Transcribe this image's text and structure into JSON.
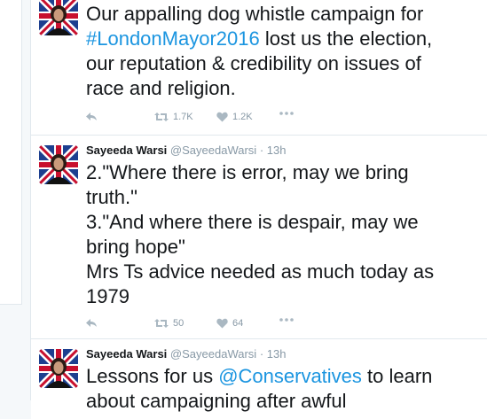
{
  "tweets": [
    {
      "author": "",
      "handle": "",
      "time": "",
      "text_lines": [
        [
          "Our appalling dog whistle campaign for"
        ],
        [
          "#LondonMayor2016",
          " lost us the election,"
        ],
        [
          "our reputation & credibility on issues of"
        ],
        [
          "race and religion."
        ]
      ],
      "retweets": "1.7K",
      "likes": "1.2K"
    },
    {
      "author": "Sayeeda Warsi",
      "handle": "@SayeedaWarsi",
      "separator": "·",
      "time": "13h",
      "text_lines": [
        "2.\"Where there is error, may we bring",
        "truth.\"",
        "3.\"And where there is despair, may we",
        "bring hope\"",
        "Mrs Ts advice needed as much today as",
        "1979"
      ],
      "retweets": "50",
      "likes": "64"
    },
    {
      "author": "Sayeeda Warsi",
      "handle": "@SayeedaWarsi",
      "separator": "·",
      "time": "13h",
      "text_line1": [
        "Lessons for us ",
        "@Conservatives",
        " to learn"
      ],
      "text_line2": "about campaigning after awful"
    }
  ],
  "icons": {
    "reply": "reply-icon",
    "retweet": "retweet-icon",
    "like": "heart-icon",
    "more": "more-icon",
    "avatar": "avatar"
  },
  "colors": {
    "link": "#1b95e0",
    "meta": "#8899a6",
    "text": "#14171a",
    "background": "#f5f8fa",
    "border": "#e1e8ed"
  }
}
